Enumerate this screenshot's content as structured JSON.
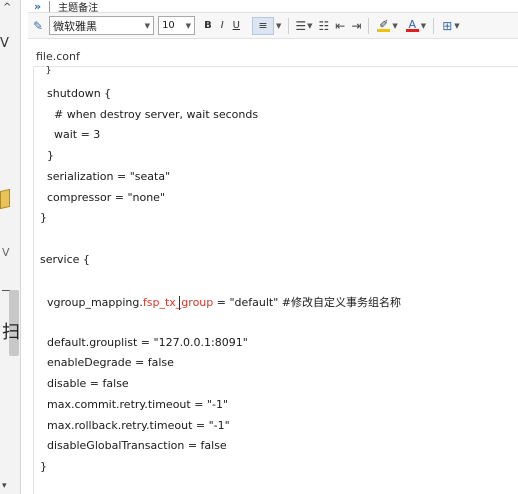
{
  "header": {
    "chevron": "»",
    "title": "主题备注"
  },
  "toolbar": {
    "font": "微软雅黑",
    "size": "10",
    "bold": "B",
    "italic": "I",
    "underline": "U",
    "highlight_color": "#f2c200",
    "font_color": "#e02020"
  },
  "editor": {
    "filename": "file.conf",
    "lines": [
      "  }",
      "  shutdown {",
      "    # when destroy server, wait seconds",
      "    wait = 3",
      "  }",
      "  serialization = \"seata\"",
      "  compressor = \"none\"",
      "}",
      "service {",
      "  vgroup_mapping.",
      "fsp_tx_group",
      " = \"default\" #修改自定义事务组名称",
      "  default.grouplist = \"127.0.0.1:8091\"",
      "  enableDegrade = false",
      "  disable = false",
      "  max.commit.retry.timeout = \"-1\"",
      "  max.rollback.retry.timeout = \"-1\"",
      "  disableGlobalTransaction = false",
      "}"
    ]
  },
  "left_strip": {
    "caret": "^",
    "letter": "V",
    "v": "V",
    "glyph": "扫"
  }
}
